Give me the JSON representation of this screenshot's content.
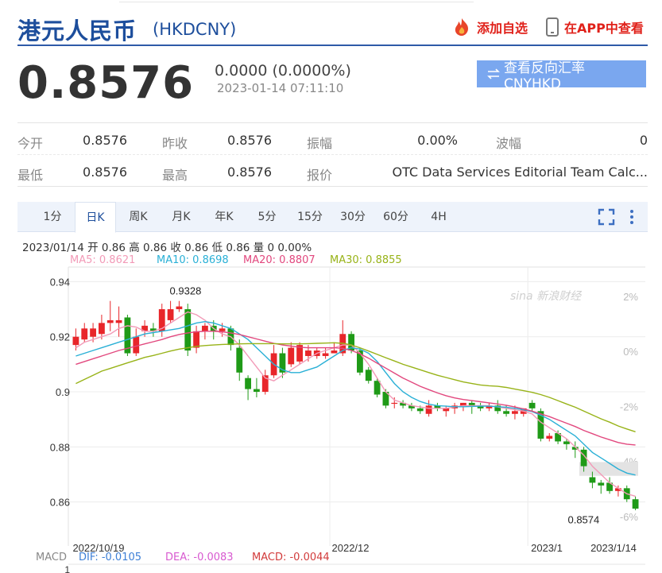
{
  "header": {
    "title": "港元人民币",
    "code": "(HKDCNY)",
    "add_watch": "添加自选",
    "view_in_app": "在APP中查看"
  },
  "quote": {
    "price": "0.8576",
    "change": "0.0000 (0.0000%)",
    "time": "2023-01-14 07:11:10",
    "reverse_button": "查看反向汇率 CNYHKD"
  },
  "stats": {
    "row1": [
      {
        "label": "今开",
        "value": "0.8576"
      },
      {
        "label": "昨收",
        "value": "0.8576"
      },
      {
        "label": "振幅",
        "value": "0.00%"
      },
      {
        "label": "波幅",
        "value": "0"
      }
    ],
    "row2": [
      {
        "label": "最低",
        "value": "0.8576"
      },
      {
        "label": "最高",
        "value": "0.8576"
      },
      {
        "label": "报价",
        "value": "OTC Data Services Editorial Team Calc..."
      }
    ]
  },
  "tabs": [
    "1分",
    "日K",
    "周K",
    "月K",
    "年K",
    "5分",
    "15分",
    "30分",
    "60分",
    "4H"
  ],
  "active_tab": "日K",
  "chart_info": {
    "line": "2023/01/14 开 0.86 高 0.86 收 0.86 低 0.86 量 0 0.00%",
    "ma": [
      {
        "text": "MA5: 0.8621",
        "color": "#f29ab7"
      },
      {
        "text": "MA10: 0.8698",
        "color": "#2ab0d6"
      },
      {
        "text": "MA20: 0.8807",
        "color": "#e2487e"
      },
      {
        "text": "MA30: 0.8855",
        "color": "#98b318"
      }
    ],
    "macd": [
      {
        "text": "MACD",
        "color": "#888888"
      },
      {
        "text": "DIF: -0.0105",
        "color": "#3d7fd6"
      },
      {
        "text": "DEA: -0.0083",
        "color": "#d85ad0"
      },
      {
        "text": "MACD: -0.0044",
        "color": "#d23b3b"
      }
    ],
    "macd_axis_label": "1",
    "watermark": "新浪财经"
  },
  "colors": {
    "up": "#e8262a",
    "down": "#1f9a17",
    "brand": "#1d4e9c",
    "accent_red": "#e0211a",
    "button": "#7aa7ef"
  },
  "chart_data": {
    "type": "candlestick",
    "title": "",
    "ylim": [
      0.855,
      0.943
    ],
    "y_ticks": [
      "0.94",
      "0.92",
      "0.9",
      "0.88",
      "0.86"
    ],
    "y_tick_values": [
      0.94,
      0.92,
      0.9,
      0.88,
      0.86
    ],
    "right_ticks": [
      "2%",
      "0%",
      "-2%",
      "-4%",
      "-6%"
    ],
    "right_tick_values": [
      0.9347,
      0.9147,
      0.8947,
      0.8747,
      0.8547
    ],
    "x_labels": [
      "2022/10/19",
      "2022/12",
      "2023/1",
      "2023/1/14"
    ],
    "x_label_index": [
      0,
      30,
      53,
      61
    ],
    "annotations": [
      {
        "text": "0.9328",
        "index": 12,
        "value": 0.9328
      },
      {
        "text": "0.8574",
        "index": 61,
        "value": 0.8574
      }
    ],
    "candles": [
      {
        "o": 0.917,
        "h": 0.923,
        "l": 0.915,
        "c": 0.92
      },
      {
        "o": 0.919,
        "h": 0.925,
        "l": 0.918,
        "c": 0.923
      },
      {
        "o": 0.92,
        "h": 0.925,
        "l": 0.918,
        "c": 0.923
      },
      {
        "o": 0.921,
        "h": 0.928,
        "l": 0.919,
        "c": 0.925
      },
      {
        "o": 0.925,
        "h": 0.933,
        "l": 0.922,
        "c": 0.926
      },
      {
        "o": 0.925,
        "h": 0.931,
        "l": 0.92,
        "c": 0.926
      },
      {
        "o": 0.927,
        "h": 0.928,
        "l": 0.913,
        "c": 0.914
      },
      {
        "o": 0.914,
        "h": 0.923,
        "l": 0.913,
        "c": 0.92
      },
      {
        "o": 0.922,
        "h": 0.926,
        "l": 0.92,
        "c": 0.924
      },
      {
        "o": 0.923,
        "h": 0.925,
        "l": 0.92,
        "c": 0.922
      },
      {
        "o": 0.922,
        "h": 0.932,
        "l": 0.92,
        "c": 0.93
      },
      {
        "o": 0.926,
        "h": 0.933,
        "l": 0.925,
        "c": 0.93
      },
      {
        "o": 0.93,
        "h": 0.933,
        "l": 0.929,
        "c": 0.931
      },
      {
        "o": 0.93,
        "h": 0.932,
        "l": 0.913,
        "c": 0.915
      },
      {
        "o": 0.916,
        "h": 0.924,
        "l": 0.914,
        "c": 0.922
      },
      {
        "o": 0.922,
        "h": 0.925,
        "l": 0.919,
        "c": 0.924
      },
      {
        "o": 0.924,
        "h": 0.926,
        "l": 0.919,
        "c": 0.922
      },
      {
        "o": 0.922,
        "h": 0.925,
        "l": 0.92,
        "c": 0.923
      },
      {
        "o": 0.923,
        "h": 0.924,
        "l": 0.915,
        "c": 0.917
      },
      {
        "o": 0.916,
        "h": 0.919,
        "l": 0.904,
        "c": 0.907
      },
      {
        "o": 0.905,
        "h": 0.906,
        "l": 0.897,
        "c": 0.901
      },
      {
        "o": 0.901,
        "h": 0.905,
        "l": 0.898,
        "c": 0.9
      },
      {
        "o": 0.9,
        "h": 0.908,
        "l": 0.899,
        "c": 0.906
      },
      {
        "o": 0.906,
        "h": 0.917,
        "l": 0.905,
        "c": 0.914
      },
      {
        "o": 0.914,
        "h": 0.916,
        "l": 0.905,
        "c": 0.907
      },
      {
        "o": 0.91,
        "h": 0.918,
        "l": 0.909,
        "c": 0.916
      },
      {
        "o": 0.911,
        "h": 0.918,
        "l": 0.91,
        "c": 0.917
      },
      {
        "o": 0.913,
        "h": 0.917,
        "l": 0.911,
        "c": 0.915
      },
      {
        "o": 0.913,
        "h": 0.916,
        "l": 0.912,
        "c": 0.915
      },
      {
        "o": 0.913,
        "h": 0.916,
        "l": 0.912,
        "c": 0.914
      },
      {
        "o": 0.914,
        "h": 0.918,
        "l": 0.914,
        "c": 0.915
      },
      {
        "o": 0.914,
        "h": 0.926,
        "l": 0.913,
        "c": 0.921
      },
      {
        "o": 0.921,
        "h": 0.922,
        "l": 0.914,
        "c": 0.915
      },
      {
        "o": 0.915,
        "h": 0.916,
        "l": 0.906,
        "c": 0.907
      },
      {
        "o": 0.908,
        "h": 0.909,
        "l": 0.903,
        "c": 0.904
      },
      {
        "o": 0.904,
        "h": 0.905,
        "l": 0.898,
        "c": 0.899
      },
      {
        "o": 0.9,
        "h": 0.901,
        "l": 0.894,
        "c": 0.895
      },
      {
        "o": 0.896,
        "h": 0.898,
        "l": 0.894,
        "c": 0.896
      },
      {
        "o": 0.896,
        "h": 0.897,
        "l": 0.894,
        "c": 0.895
      },
      {
        "o": 0.895,
        "h": 0.896,
        "l": 0.893,
        "c": 0.894
      },
      {
        "o": 0.894,
        "h": 0.895,
        "l": 0.892,
        "c": 0.893
      },
      {
        "o": 0.892,
        "h": 0.897,
        "l": 0.891,
        "c": 0.895
      },
      {
        "o": 0.895,
        "h": 0.896,
        "l": 0.893,
        "c": 0.894
      },
      {
        "o": 0.893,
        "h": 0.895,
        "l": 0.891,
        "c": 0.894
      },
      {
        "o": 0.894,
        "h": 0.896,
        "l": 0.892,
        "c": 0.895
      },
      {
        "o": 0.895,
        "h": 0.896,
        "l": 0.893,
        "c": 0.896
      },
      {
        "o": 0.896,
        "h": 0.897,
        "l": 0.892,
        "c": 0.895
      },
      {
        "o": 0.895,
        "h": 0.896,
        "l": 0.893,
        "c": 0.894
      },
      {
        "o": 0.894,
        "h": 0.896,
        "l": 0.893,
        "c": 0.895
      },
      {
        "o": 0.895,
        "h": 0.897,
        "l": 0.892,
        "c": 0.893
      },
      {
        "o": 0.893,
        "h": 0.895,
        "l": 0.891,
        "c": 0.892
      },
      {
        "o": 0.892,
        "h": 0.895,
        "l": 0.89,
        "c": 0.893
      },
      {
        "o": 0.892,
        "h": 0.894,
        "l": 0.891,
        "c": 0.894
      },
      {
        "o": 0.896,
        "h": 0.897,
        "l": 0.893,
        "c": 0.894
      },
      {
        "o": 0.893,
        "h": 0.894,
        "l": 0.882,
        "c": 0.883
      },
      {
        "o": 0.883,
        "h": 0.885,
        "l": 0.882,
        "c": 0.884
      },
      {
        "o": 0.885,
        "h": 0.886,
        "l": 0.881,
        "c": 0.882
      },
      {
        "o": 0.882,
        "h": 0.883,
        "l": 0.879,
        "c": 0.881
      },
      {
        "o": 0.88,
        "h": 0.882,
        "l": 0.876,
        "c": 0.879
      },
      {
        "o": 0.879,
        "h": 0.88,
        "l": 0.871,
        "c": 0.873
      },
      {
        "o": 0.869,
        "h": 0.871,
        "l": 0.865,
        "c": 0.867
      },
      {
        "o": 0.867,
        "h": 0.868,
        "l": 0.863,
        "c": 0.866
      },
      {
        "o": 0.867,
        "h": 0.869,
        "l": 0.863,
        "c": 0.864
      },
      {
        "o": 0.864,
        "h": 0.866,
        "l": 0.862,
        "c": 0.865
      },
      {
        "o": 0.865,
        "h": 0.866,
        "l": 0.86,
        "c": 0.861
      },
      {
        "o": 0.861,
        "h": 0.862,
        "l": 0.857,
        "c": 0.8576
      }
    ],
    "series": [
      {
        "name": "MA5",
        "color": "#f29ab7",
        "values": [
          0.916,
          0.918,
          0.919,
          0.92,
          0.921,
          0.923,
          0.924,
          0.9235,
          0.922,
          0.922,
          0.923,
          0.925,
          0.927,
          0.929,
          0.928,
          0.926,
          0.923,
          0.921,
          0.92,
          0.917,
          0.913,
          0.909,
          0.905,
          0.904,
          0.906,
          0.908,
          0.91,
          0.912,
          0.914,
          0.915,
          0.916,
          0.917,
          0.917,
          0.914,
          0.91,
          0.905,
          0.9,
          0.897,
          0.896,
          0.895,
          0.8945,
          0.894,
          0.894,
          0.894,
          0.8945,
          0.895,
          0.895,
          0.895,
          0.895,
          0.8945,
          0.894,
          0.8935,
          0.893,
          0.892,
          0.889,
          0.887,
          0.885,
          0.883,
          0.88,
          0.877,
          0.873,
          0.87,
          0.867,
          0.865,
          0.863,
          0.8621
        ]
      },
      {
        "name": "MA10",
        "color": "#2ab0d6",
        "values": [
          0.913,
          0.914,
          0.915,
          0.916,
          0.917,
          0.918,
          0.919,
          0.92,
          0.921,
          0.9215,
          0.922,
          0.9225,
          0.923,
          0.924,
          0.925,
          0.9255,
          0.925,
          0.924,
          0.923,
          0.921,
          0.919,
          0.916,
          0.913,
          0.91,
          0.908,
          0.907,
          0.907,
          0.908,
          0.909,
          0.911,
          0.913,
          0.915,
          0.916,
          0.9155,
          0.914,
          0.911,
          0.907,
          0.903,
          0.9,
          0.898,
          0.8965,
          0.8955,
          0.895,
          0.8948,
          0.8946,
          0.8946,
          0.8947,
          0.8948,
          0.8948,
          0.8946,
          0.8944,
          0.894,
          0.8935,
          0.8928,
          0.8915,
          0.89,
          0.888,
          0.886,
          0.884,
          0.881,
          0.878,
          0.876,
          0.874,
          0.872,
          0.8705,
          0.8698
        ]
      },
      {
        "name": "MA20",
        "color": "#e2487e",
        "values": [
          0.91,
          0.911,
          0.912,
          0.913,
          0.914,
          0.915,
          0.9158,
          0.9166,
          0.9174,
          0.9182,
          0.919,
          0.92,
          0.9208,
          0.9214,
          0.9218,
          0.922,
          0.922,
          0.9218,
          0.9214,
          0.9208,
          0.92,
          0.9192,
          0.9184,
          0.9176,
          0.917,
          0.9166,
          0.9162,
          0.916,
          0.916,
          0.916,
          0.916,
          0.9158,
          0.915,
          0.9138,
          0.9122,
          0.9104,
          0.9086,
          0.9068,
          0.905,
          0.9035,
          0.902,
          0.9008,
          0.8996,
          0.8986,
          0.8978,
          0.8972,
          0.8968,
          0.8964,
          0.896,
          0.8956,
          0.8951,
          0.8945,
          0.8938,
          0.893,
          0.892,
          0.891,
          0.8898,
          0.8886,
          0.8874,
          0.886,
          0.8848,
          0.8836,
          0.8826,
          0.8816,
          0.881,
          0.8807
        ]
      },
      {
        "name": "MA30",
        "color": "#98b318",
        "values": [
          0.903,
          0.9045,
          0.906,
          0.9075,
          0.9085,
          0.9095,
          0.9105,
          0.9115,
          0.9125,
          0.9132,
          0.914,
          0.9148,
          0.9155,
          0.916,
          0.9165,
          0.9168,
          0.917,
          0.9172,
          0.9173,
          0.9174,
          0.9175,
          0.9175,
          0.9175,
          0.9175,
          0.9174,
          0.9174,
          0.9174,
          0.9175,
          0.9176,
          0.9177,
          0.9178,
          0.9176,
          0.917,
          0.916,
          0.9148,
          0.9136,
          0.9124,
          0.9112,
          0.91,
          0.909,
          0.908,
          0.907,
          0.906,
          0.9052,
          0.9044,
          0.9036,
          0.903,
          0.9025,
          0.9022,
          0.902,
          0.9016,
          0.901,
          0.9004,
          0.8998,
          0.899,
          0.898,
          0.8968,
          0.8956,
          0.8944,
          0.893,
          0.8916,
          0.8902,
          0.889,
          0.8876,
          0.8865,
          0.8855
        ]
      }
    ]
  }
}
